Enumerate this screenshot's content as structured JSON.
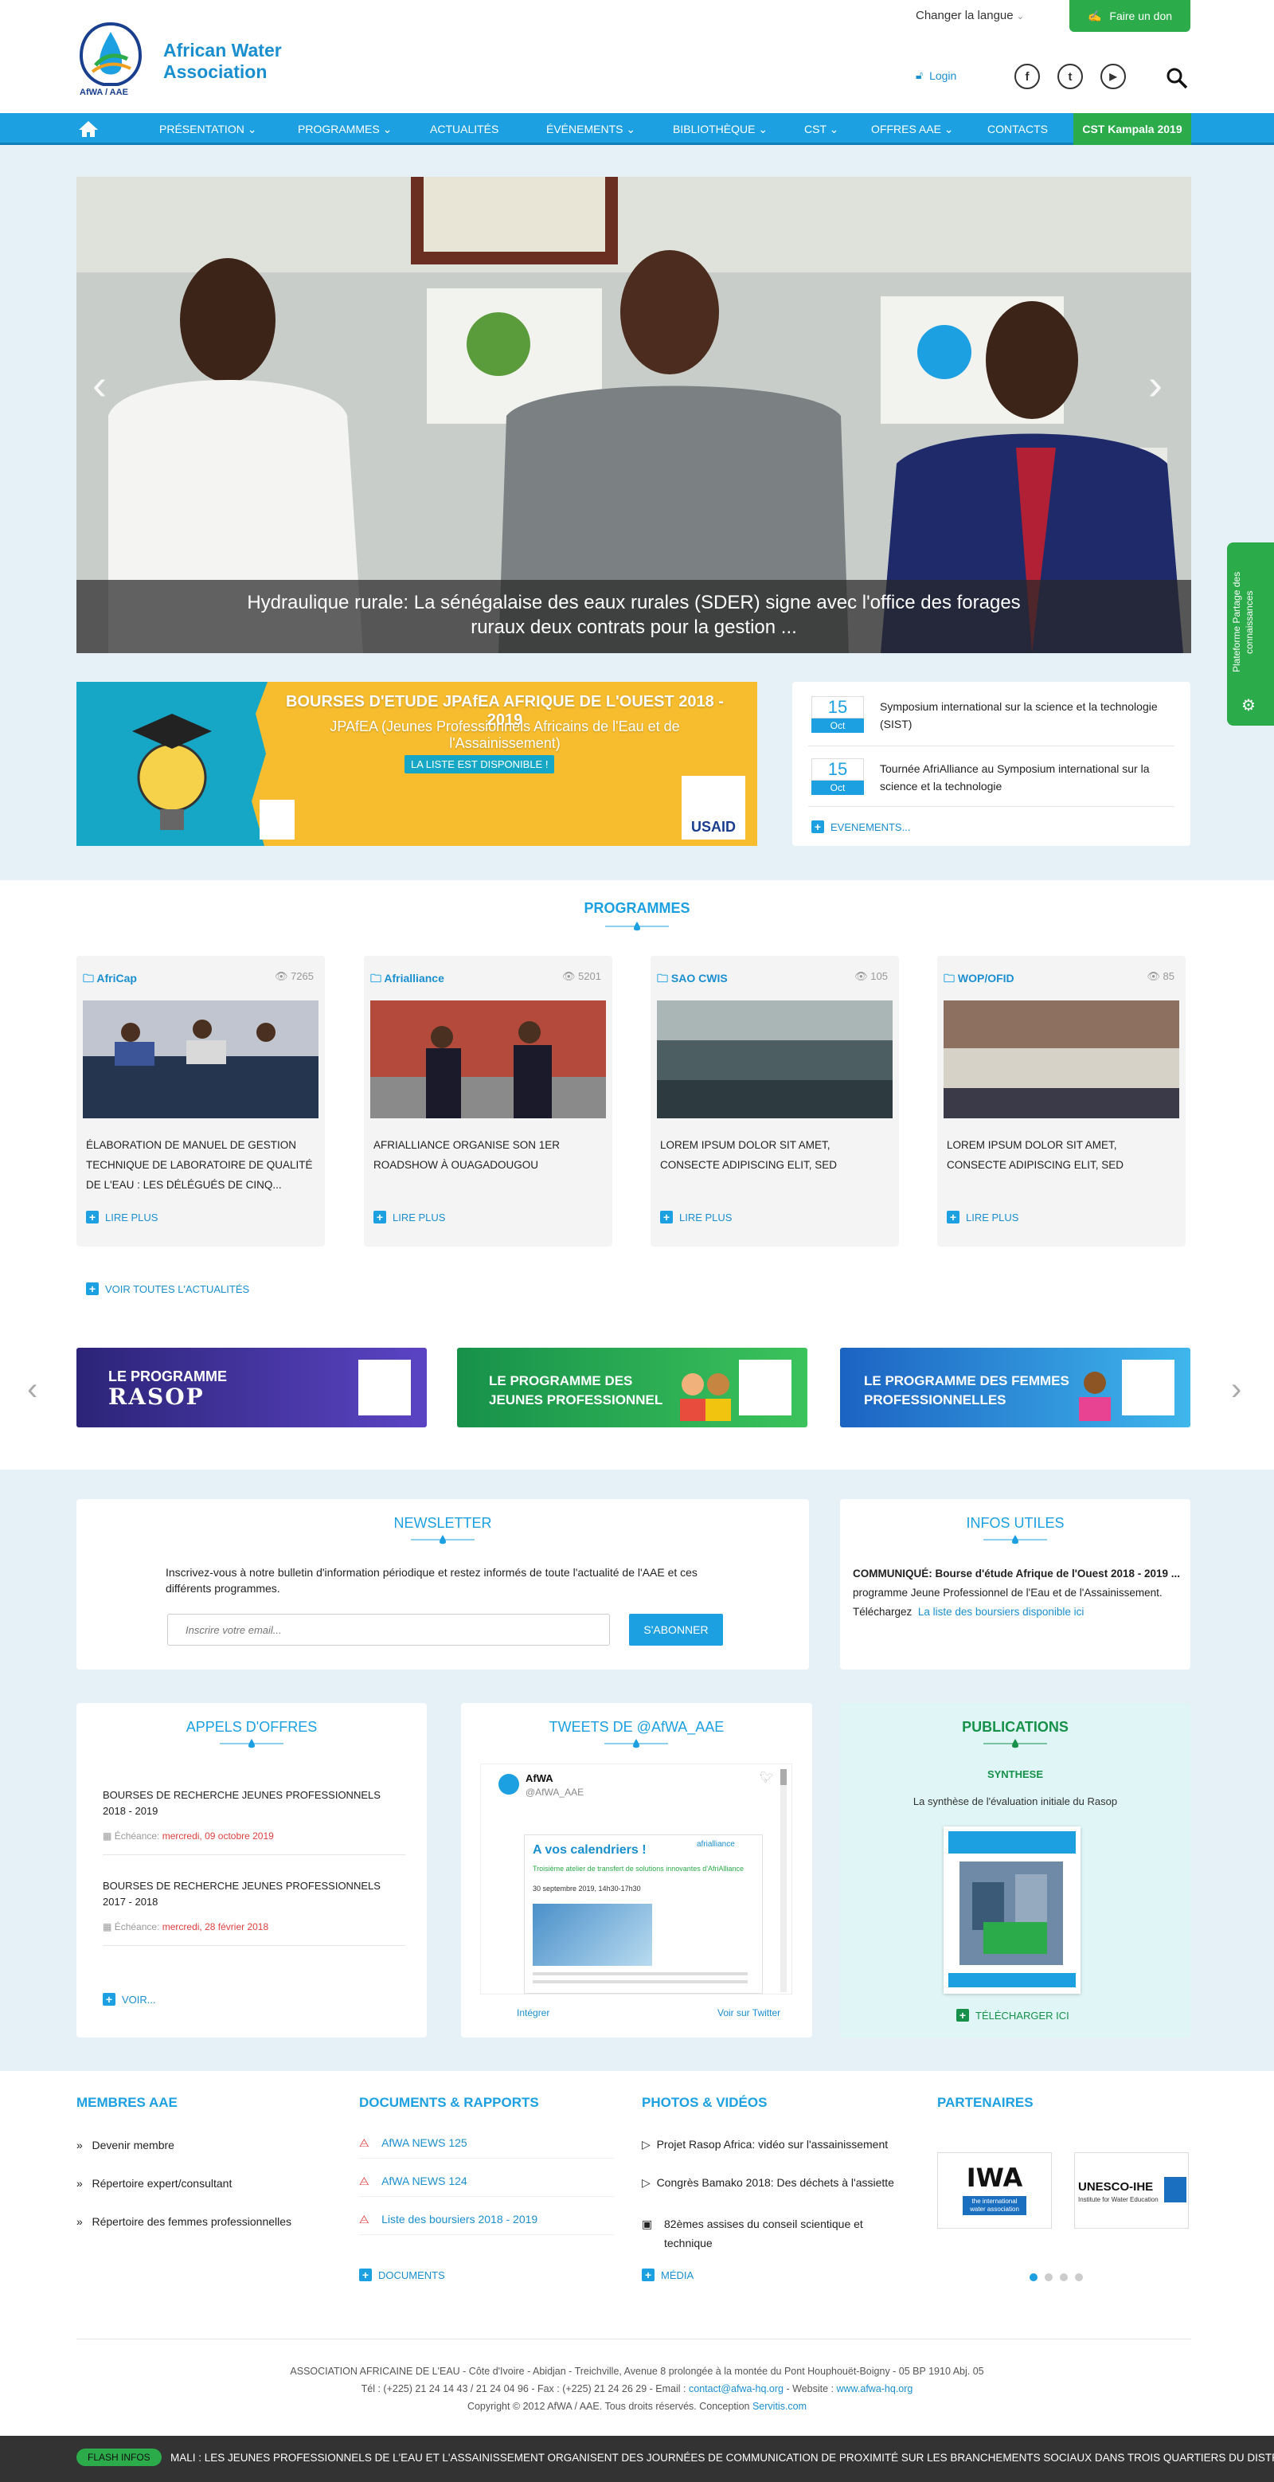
{
  "header": {
    "brand_line1": "African Water",
    "brand_line2": "Association",
    "logo_text": "AfWA / AAE",
    "lang": "Changer la langue",
    "donate": "Faire un don",
    "login": "Login",
    "social": [
      {
        "icon": "facebook-icon",
        "glyph": "f"
      },
      {
        "icon": "twitter-icon",
        "glyph": "t"
      },
      {
        "icon": "youtube-icon",
        "glyph": "▶"
      }
    ]
  },
  "nav": {
    "items": [
      "PRÉSENTATION",
      "PROGRAMMES",
      "ACTUALITÉS",
      "ÉVÉNEMENTS",
      "BIBLIOTHÈQUE",
      "CST",
      "OFFRES AAE",
      "CONTACTS"
    ],
    "highlight": "CST Kampala 2019"
  },
  "hero": {
    "caption": "Hydraulique rurale: La sénégalaise des eaux rurales (SDER) signe avec l'office des forages ruraux deux contrats pour la gestion ..."
  },
  "side_tab": "Plateforme Partage des connaissances",
  "bourses": {
    "title": "BOURSES D'ETUDE JPAfEA AFRIQUE DE L'OUEST 2018 - 2019",
    "subtitle": "JPAfEA (Jeunes Professionnels Africains de l'Eau et de l'Assainissement)",
    "button": "LA LISTE EST DISPONIBLE !",
    "usaid": "USAID"
  },
  "events": {
    "items": [
      {
        "day": "15",
        "month": "Oct",
        "text": "Symposium international sur la science et la technologie (SIST)"
      },
      {
        "day": "15",
        "month": "Oct",
        "text": "Tournée AfriAlliance au Symposium international sur la science et la technologie"
      }
    ],
    "more": "EVENEMENTS..."
  },
  "programmes": {
    "title": "PROGRAMMES",
    "cards": [
      {
        "cat": "AfriCap",
        "views": "7265",
        "text": "ÉLABORATION DE MANUEL DE GESTION TECHNIQUE DE LABORATOIRE DE QUALITÉ DE L'EAU : LES DÉLÉGUÉS DE CINQ...",
        "more": "LIRE PLUS"
      },
      {
        "cat": "Afrialliance",
        "views": "5201",
        "text": "AFRIALLIANCE ORGANISE SON 1er ROADSHOW à OUAGADOUGOU",
        "more": "LIRE PLUS"
      },
      {
        "cat": "SAO CWIS",
        "views": "105",
        "text": "LOREM IPSUM DOLOR SIT AMET, CONSECTE ADIPISCING ELIT, SED",
        "more": "LIRE PLUS"
      },
      {
        "cat": "WOP/OFID",
        "views": "85",
        "text": "LOREM IPSUM DOLOR SIT AMET, CONSECTE ADIPISCING ELIT, SED",
        "more": "LIRE PLUS"
      }
    ],
    "all": "VOIR TOUTES L'ACTUALITÉS"
  },
  "promos": [
    {
      "line1": "LE PROGRAMME",
      "line2": "RASOP",
      "color1": "#3b2f8f",
      "color2": "#6a4fd0"
    },
    {
      "line1": "LE PROGRAMME DES",
      "line2": "JEUNES PROFESSIONNEL",
      "color1": "#1f9a48",
      "color2": "#3cc35c"
    },
    {
      "line1": "LE PROGRAMME DES FEMMES",
      "line2": "PROFESSIONNELLES",
      "color1": "#1f6fc8",
      "color2": "#3db0ea"
    }
  ],
  "newsletter": {
    "title": "NEWSLETTER",
    "text": "Inscrivez-vous à notre bulletin d'information périodique et restez informés de toute l'actualité de l'AAE et ces différents programmes.",
    "placeholder": "Inscrire votre email...",
    "button": "S'ABONNER"
  },
  "infos": {
    "title": "INFOS UTILES",
    "bold": "COMMUNIQUÉ: Bourse d'étude Afrique de l'Ouest 2018 - 2019 ...",
    "line2": "programme Jeune Professionnel de l'Eau et de l'Assainissement.",
    "line3_prefix": "Téléchargez",
    "link": "La liste des boursiers disponible ici"
  },
  "appels": {
    "title": "APPELS D'OFFRES",
    "items": [
      {
        "title": "BOURSES DE RECHERCHE JEUNES PROFESSIONNELS 2018 - 2019",
        "label": "Échéance:",
        "date": "mercredi, 09 octobre 2019"
      },
      {
        "title": "BOURSES DE RECHERCHE JEUNES PROFESSIONNELS 2017 - 2018",
        "label": "Échéance:",
        "date": "mercredi, 28 février 2018"
      }
    ],
    "more": "VOIR..."
  },
  "tweets": {
    "title": "TWEETS DE @AfWA_AAE",
    "name": "AfWA",
    "handle": "@AfWA_AAE",
    "headline": "A vos calendriers !",
    "subhead": "Troisième atelier de transfert de solutions innovantes d'AfriAlliance",
    "date": "30 septembre 2019, 14h30-17h30",
    "brand": "afrialliance",
    "embed": "Intégrer",
    "view": "Voir sur Twitter"
  },
  "publications": {
    "title": "PUBLICATIONS",
    "subtitle": "SYNTHESE",
    "desc": "La synthèse de l'évaluation initiale du Rasop",
    "download": "TÉLÉCHARGER ICI"
  },
  "footer": {
    "membres": {
      "title": "MEMBRES AAE",
      "items": [
        "Devenir membre",
        "Répertoire expert/consultant",
        "Répertoire des femmes professionnelles"
      ]
    },
    "docs": {
      "title": "DOCUMENTS & RAPPORTS",
      "items": [
        "AfWA NEWS 125",
        "AfWA NEWS 124",
        "Liste des boursiers 2018 - 2019"
      ],
      "more": "DOCUMENTS"
    },
    "photos": {
      "title": "PHOTOS & VIDÉOS",
      "items": [
        "Projet Rasop Africa: vidéo sur l'assainissement",
        "Congrès Bamako 2018: Des déchets à l'assiette",
        "82èmes assises du conseil scientique et technique"
      ],
      "more": "MÉDIA"
    },
    "partenaires": {
      "title": "PARTENAIRES",
      "iwa": "IWA",
      "iwa_sub": "the international water association",
      "unesco": "UNESCO-IHE",
      "unesco_sub": "Institute for Water Education"
    },
    "address": "ASSOCIATION AFRICAINE DE L'EAU - Côte d'Ivoire - Abidjan - Treichville, Avenue 8 prolongée à la montée du Pont Houphouët-Boigny - 05 BP 1910 Abj. 05",
    "contact_prefix": "Tél : (+225) 21 24 14 43 / 21 24 04 96 - Fax : (+225) 21 24 26 29 - Email :",
    "email": "contact@afwa-hq.org",
    "website_label": "- Website :",
    "website": "www.afwa-hq.org",
    "copyright_prefix": "Copyright © 2012 AfWA / AAE. Tous droits réservés. Conception",
    "designer": "Servitis.com"
  },
  "flash": {
    "label": "FLASH INFOS",
    "text": "MALI : LES JEUNES PROFESSIONNELS DE L'EAU ET L'ASSAINISSEMENT ORGANISENT DES JOURNÉES DE COMMUNICATION DE PROXIMITÉ SUR LES BRANCHEMENTS SOCIAUX DANS TROIS QUARTIERS DU DISTRICT DE B"
  }
}
